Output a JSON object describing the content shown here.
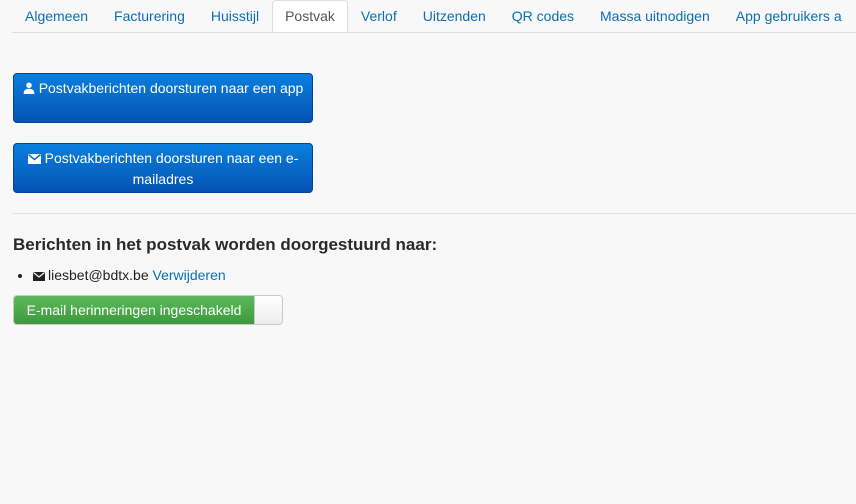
{
  "tabs": [
    {
      "label": "Algemeen"
    },
    {
      "label": "Facturering"
    },
    {
      "label": "Huisstijl"
    },
    {
      "label": "Postvak",
      "active": true
    },
    {
      "label": "Verlof"
    },
    {
      "label": "Uitzenden"
    },
    {
      "label": "QR codes"
    },
    {
      "label": "Massa uitnodigen"
    },
    {
      "label": "App gebruikers a"
    }
  ],
  "buttons": {
    "forward_app": {
      "label": "Postvakberichten doorsturen naar een app",
      "icon": "user-icon"
    },
    "forward_email": {
      "label": "Postvakberichten doorsturen naar een e-mailadres",
      "icon": "envelope-icon"
    }
  },
  "forwarding": {
    "title": "Berichten in het postvak worden doorgestuurd naar:",
    "recipients": [
      {
        "email": "liesbet@bdtx.be",
        "remove_label": "Verwijderen",
        "icon": "envelope-icon"
      }
    ]
  },
  "reminder_toggle": {
    "label": "E-mail herinneringen ingeschakeld",
    "state": "on"
  },
  "colors": {
    "link": "#0c6fb3",
    "primary_button": "#0663c7",
    "toggle_on": "#4cae4c"
  }
}
